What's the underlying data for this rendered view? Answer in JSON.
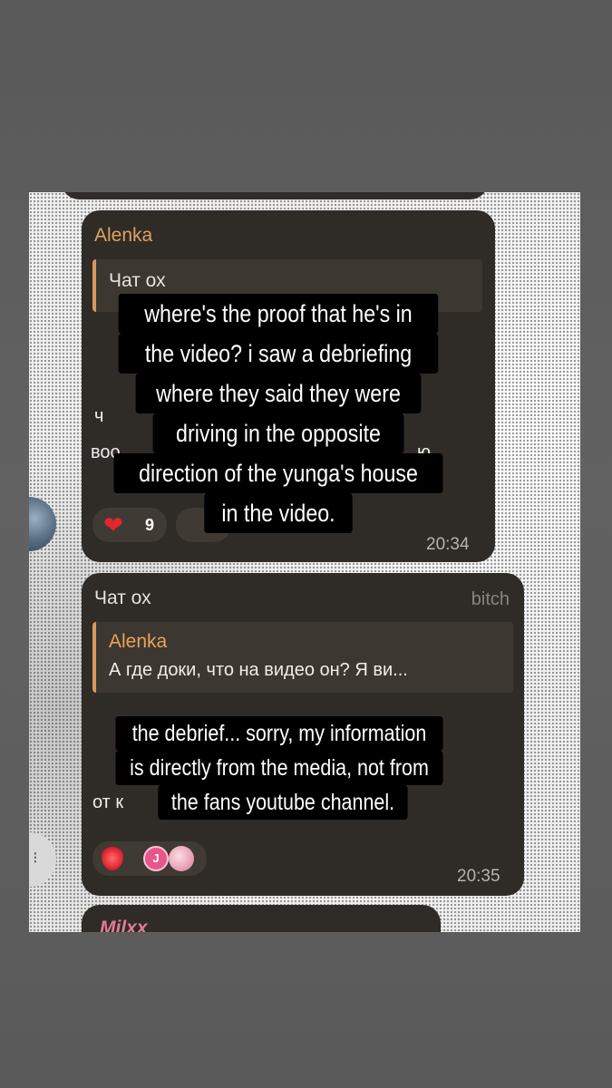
{
  "colors": {
    "bubble": "#2f2b27",
    "quote_bar": "#d69a5e",
    "sender_alenka": "#e0a25e",
    "sender_chat": "#e5e2de",
    "quote_sender": "#e9a35a",
    "time": "#b9b3ad",
    "overlay": "#000000"
  },
  "message1": {
    "sender": "Alenka",
    "reply_to": {
      "sender": "Чат ох"
    },
    "visible_fragments": [
      "ч",
      "воо",
      "ю"
    ],
    "reactions": [
      {
        "icon": "heart-icon",
        "count": "9"
      }
    ],
    "time": "20:34"
  },
  "message2": {
    "sender": "Чат ох",
    "tag": "bitch",
    "reply_to": {
      "sender": "Alenka",
      "text": "А где доки, что на видео он? Я ви..."
    },
    "visible_fragments": [
      "от к"
    ],
    "reactions": [
      {
        "icon": "strawberry-icon"
      },
      {
        "icon": "avatar-j",
        "letter": "J"
      },
      {
        "icon": "avatar-pink"
      }
    ],
    "time": "20:35"
  },
  "message3": {
    "sender": "Milxx"
  },
  "overlay1": {
    "lines": [
      "where's the proof that he's in",
      "the video? i saw a debriefing",
      "where they said they were",
      "driving in the opposite",
      "direction of the yunga's house",
      "in the video."
    ]
  },
  "overlay2": {
    "lines": [
      "the debrief... sorry, my information",
      "is directly from the media, not from",
      "the fans youtube channel."
    ]
  }
}
